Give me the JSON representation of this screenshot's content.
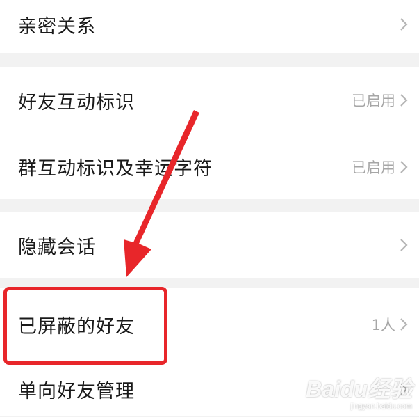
{
  "settings": {
    "rows": [
      {
        "label": "亲密关系",
        "value": ""
      },
      {
        "label": "好友互动标识",
        "value": "已启用"
      },
      {
        "label": "群互动标识及幸运字符",
        "value": "已启用"
      },
      {
        "label": "隐藏会话",
        "value": ""
      },
      {
        "label": "已屏蔽的好友",
        "value": "1人"
      },
      {
        "label": "单向好友管理",
        "value": ""
      }
    ]
  },
  "annotation": {
    "highlight_color": "#e8262a",
    "arrow_color": "#e8262a"
  },
  "watermark": {
    "main": "Baidu经验",
    "sub": "jingyan.baidu.com"
  }
}
